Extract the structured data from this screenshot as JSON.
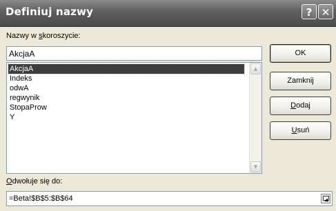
{
  "window": {
    "title": "Definiuj nazwy",
    "help_glyph": "?",
    "close_glyph": "✕"
  },
  "names_label": {
    "pre": "Nazwy w ",
    "accel": "s",
    "post": "koroszycie:"
  },
  "name_input": {
    "value": "AkcjaA"
  },
  "list": {
    "items": [
      "AkcjaA",
      "Indeks",
      "odwA",
      "regwynik",
      "StopaProw",
      "Y"
    ],
    "selected_index": 0
  },
  "refers_label": {
    "accel": "O",
    "post": "dwołuje się do:"
  },
  "refers_input": {
    "value": "=Beta!$B$5:$B$64"
  },
  "buttons": {
    "ok": "OK",
    "close": "Zamknij",
    "add_accel": "D",
    "add_rest": "odaj",
    "remove_accel": "U",
    "remove_rest": "suń"
  },
  "icons": {
    "help": "help-icon",
    "close": "close-icon",
    "scroll_up": "scroll-up-arrow-icon",
    "scroll_down": "scroll-down-arrow-icon",
    "collapse": "collapse-dialog-icon"
  }
}
